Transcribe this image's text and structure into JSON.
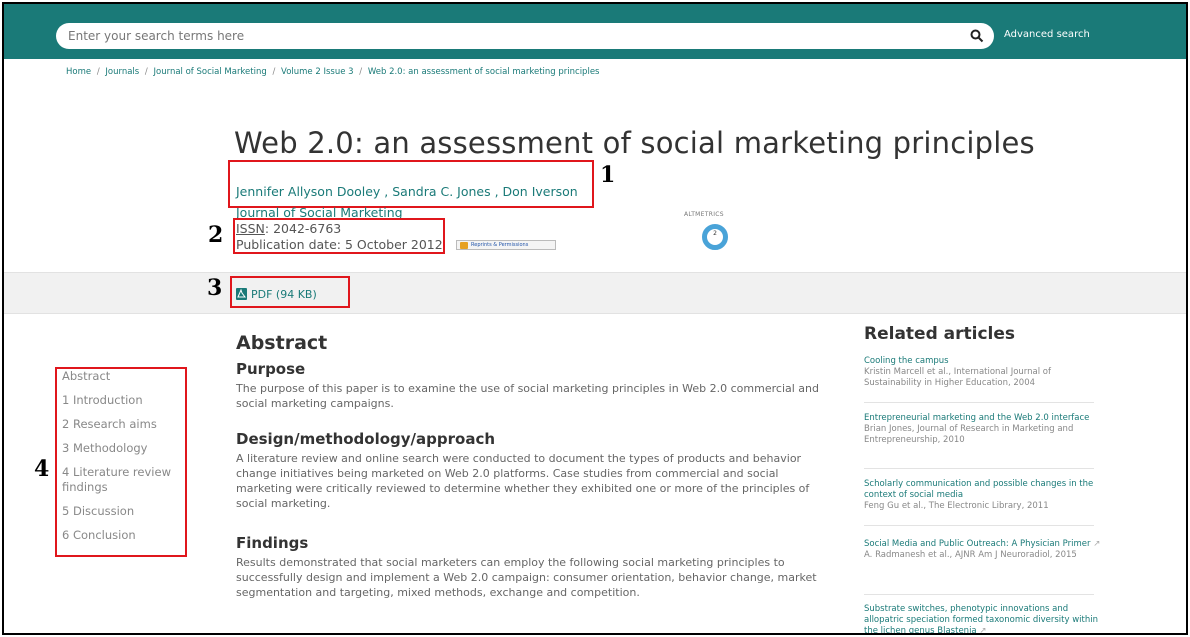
{
  "search": {
    "placeholder": "Enter your search terms here",
    "advanced_label": "Advanced search"
  },
  "breadcrumb": {
    "items": [
      "Home",
      "Journals",
      "Journal of Social Marketing",
      "Volume 2 Issue 3",
      "Web 2.0: an assessment of social marketing principles"
    ],
    "separator": "/"
  },
  "article": {
    "title": "Web 2.0: an assessment of social marketing principles",
    "authors": "Jennifer Allyson Dooley , Sandra C. Jones , Don Iverson",
    "journal": "Journal of Social Marketing",
    "issn_label": "ISSN",
    "issn_value": ": 2042-6763",
    "pub_date": "Publication date: 5 October 2012",
    "reprints_label": "Reprints & Permissions",
    "altmetrics_label": "ALTMETRICS",
    "altmetrics_score": "2",
    "pdf_label": "PDF (94 KB)"
  },
  "annotations": {
    "n1": "1",
    "n2": "2",
    "n3": "3",
    "n4": "4"
  },
  "toc": {
    "items": [
      "Abstract",
      "1 Introduction",
      "2 Research aims",
      "3 Methodology",
      "4 Literature review findings",
      "5 Discussion",
      "6 Conclusion"
    ]
  },
  "abstract": {
    "heading": "Abstract",
    "purpose_h": "Purpose",
    "purpose_p": "The purpose of this paper is to examine the use of social marketing principles in Web 2.0 commercial and social marketing campaigns.",
    "design_h": "Design/methodology/approach",
    "design_p": "A literature review and online search were conducted to document the types of products and behavior change initiatives being marketed on Web 2.0 platforms. Case studies from commercial and social marketing were critically reviewed to determine whether they exhibited one or more of the principles of social marketing.",
    "findings_h": "Findings",
    "findings_p": "Results demonstrated that social marketers can employ the following social marketing principles to successfully design and implement a Web 2.0 campaign: consumer orientation, behavior change, market segmentation and targeting, mixed methods, exchange and competition."
  },
  "related": {
    "heading": "Related articles",
    "items": [
      {
        "title": "Cooling the campus",
        "meta": "Kristin Marcell et al., International Journal of Sustainability in Higher Education, 2004"
      },
      {
        "title": "Entrepreneurial marketing and the Web 2.0 interface",
        "meta": "Brian Jones, Journal of Research in Marketing and Entrepreneurship, 2010"
      },
      {
        "title": "Scholarly communication and possible changes in the context of social media",
        "meta": "Feng Gu et al., The Electronic Library, 2011"
      },
      {
        "title": "Social Media and Public Outreach: A Physician Primer",
        "meta": "A. Radmanesh et al., AJNR Am J Neuroradiol, 2015"
      },
      {
        "title": "Substrate switches, phenotypic innovations and allopatric speciation formed taxonomic diversity within the lichen genus Blastenia",
        "meta": ""
      }
    ]
  },
  "colors": {
    "brand": "#1a7a78",
    "annotation": "#e0161c"
  }
}
